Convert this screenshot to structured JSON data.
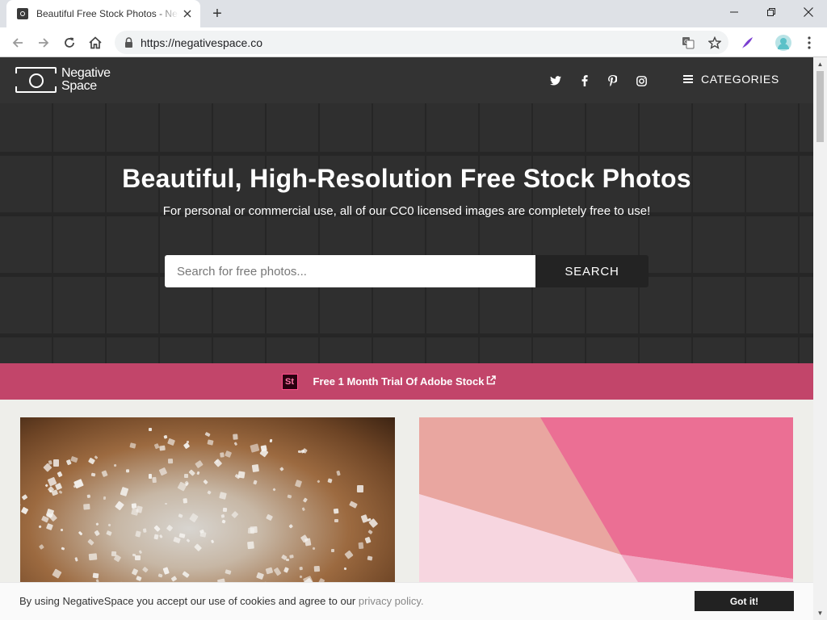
{
  "browser": {
    "tab_title": "Beautiful Free Stock Photos - Negative Space",
    "new_tab_label": "+",
    "url": "https://negativespace.co"
  },
  "site": {
    "logo": {
      "line1": "Negative",
      "line2": "Space"
    },
    "social_icons": [
      "twitter-icon",
      "facebook-icon",
      "pinterest-icon",
      "instagram-icon"
    ],
    "categories_label": "CATEGORIES",
    "colors": {
      "header_bg": "#333333",
      "promo_bg": "#c2456a",
      "button_dark": "#232323"
    }
  },
  "hero": {
    "title": "Beautiful, High-Resolution Free Stock Photos",
    "subtitle": "For personal or commercial use, all of our CC0 licensed images are completely free to use!",
    "search_placeholder": "Search for free photos...",
    "search_button": "SEARCH"
  },
  "promo": {
    "badge": "St",
    "text": "Free 1 Month Trial Of Adobe Stock"
  },
  "cookie": {
    "text": "By using NegativeSpace you accept our use of cookies and agree to our",
    "link": "privacy policy.",
    "button": "Got it!"
  }
}
